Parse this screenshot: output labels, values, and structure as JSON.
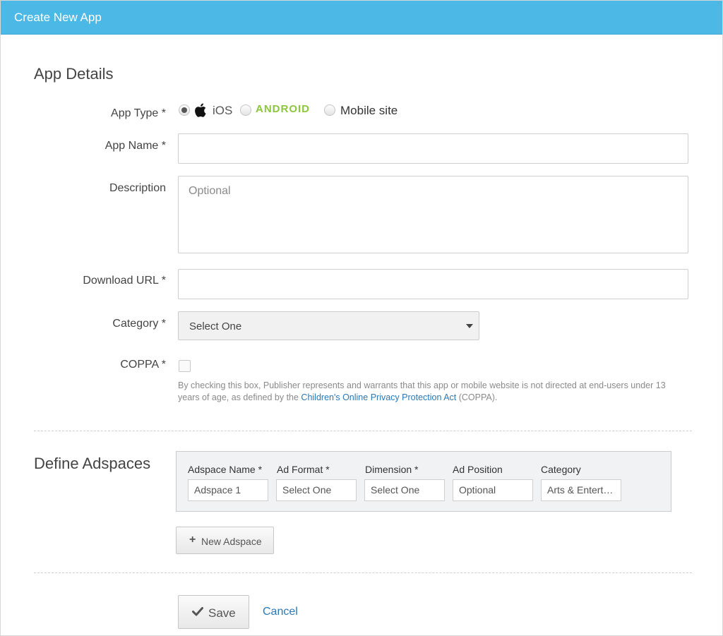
{
  "window": {
    "title": "Create New App"
  },
  "app_details": {
    "heading": "App Details",
    "app_type": {
      "label": "App Type *",
      "options": [
        {
          "name": "ios",
          "text": "iOS",
          "selected": true
        },
        {
          "name": "android",
          "text": "ANDROID",
          "selected": false
        },
        {
          "name": "mobile-site",
          "text": "Mobile site",
          "selected": false
        }
      ]
    },
    "app_name": {
      "label": "App Name *",
      "value": "",
      "placeholder": ""
    },
    "description": {
      "label": "Description",
      "value": "",
      "placeholder": "Optional"
    },
    "download_url": {
      "label": "Download URL *",
      "value": "",
      "placeholder": ""
    },
    "category": {
      "label": "Category *",
      "selected": "Select One"
    },
    "coppa": {
      "label": "COPPA *",
      "checked": false,
      "hint_before": "By checking this box, Publisher represents and warrants that this app or mobile website is not directed at end-users under 13 years of age, as defined by the ",
      "hint_link": "Children's Online Privacy Protection Act",
      "hint_after": " (COPPA)."
    }
  },
  "adspaces": {
    "heading": "Define Adspaces",
    "columns": [
      "Adspace Name *",
      "Ad Format *",
      "Dimension *",
      "Ad Position",
      "Category"
    ],
    "row": [
      "Adspace 1",
      "Select One",
      "Select One",
      "Optional",
      "Arts & Entertainment"
    ],
    "new_button": "New Adspace"
  },
  "actions": {
    "save": "Save",
    "cancel": "Cancel"
  },
  "colors": {
    "header": "#4cb8e6",
    "link": "#2a78b6",
    "android_green": "#8cc63f"
  }
}
